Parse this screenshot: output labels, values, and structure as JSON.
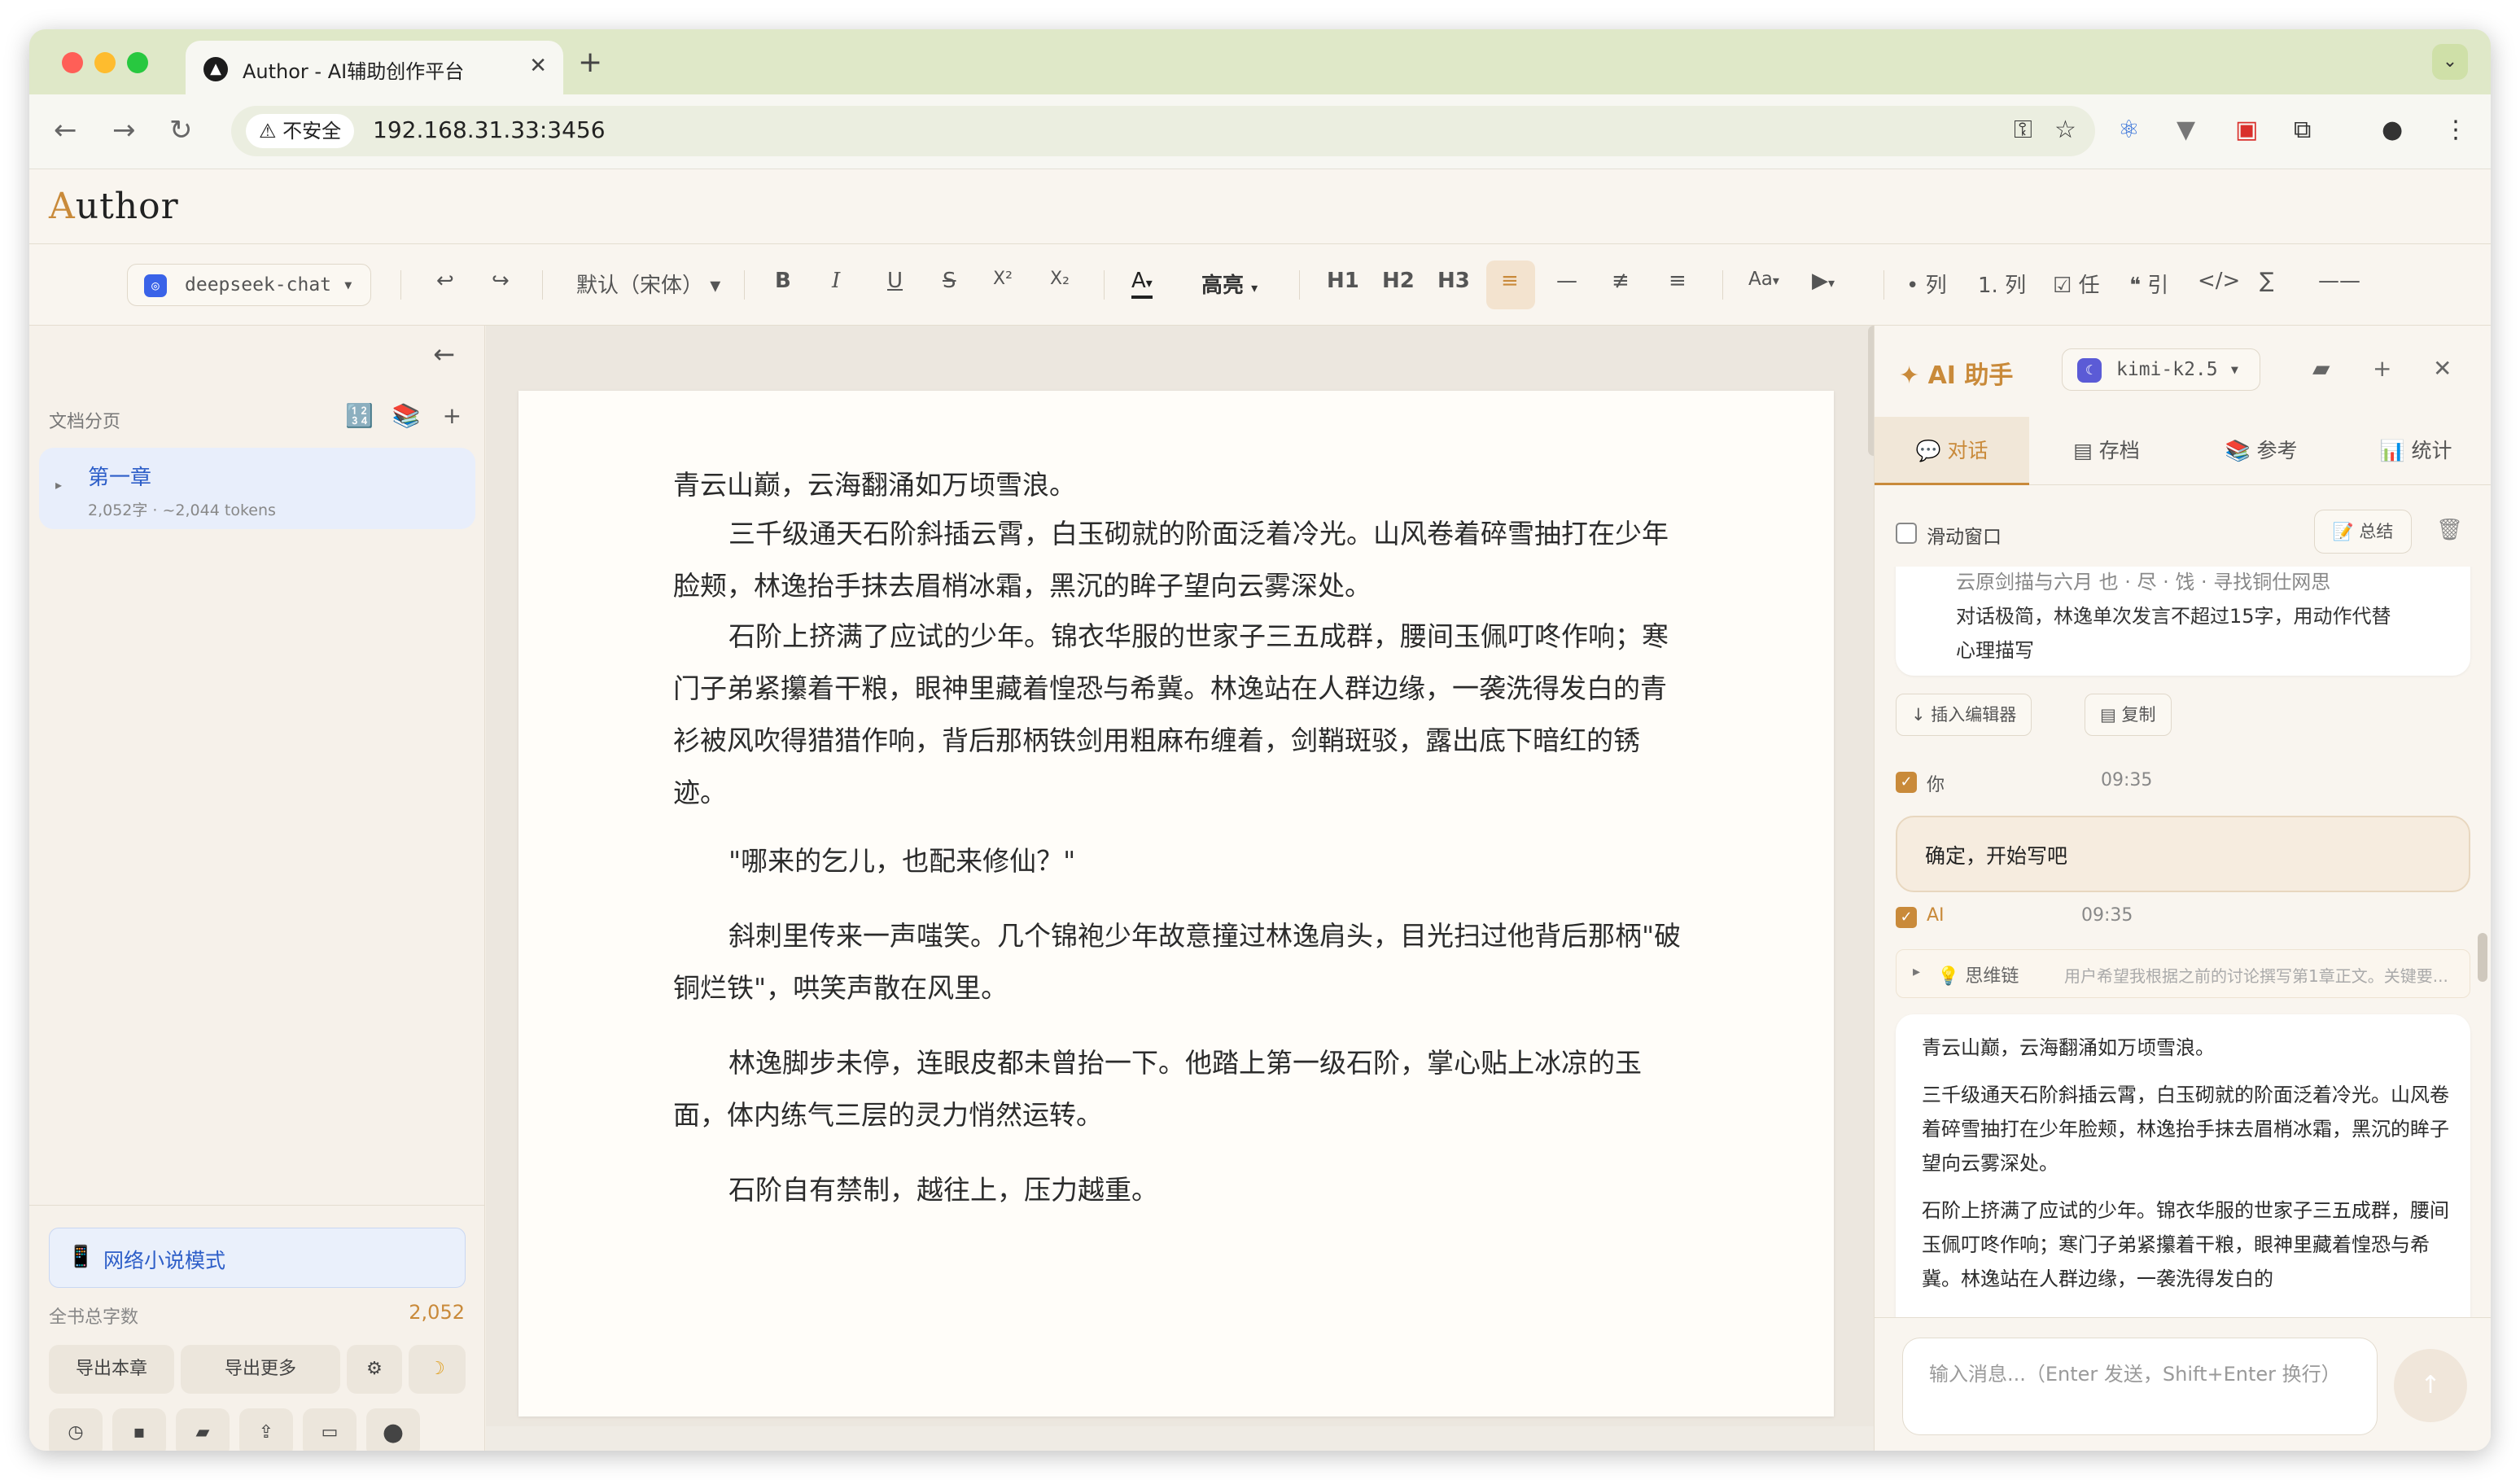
{
  "browser": {
    "tab_title": "Author - AI辅助创作平台",
    "tab_close": "✕",
    "new_tab": "+",
    "tab_menu": "⌄",
    "security_label": "不安全",
    "url": "192.168.31.33:3456",
    "traffic_colors": {
      "close": "#ff5f57",
      "minimize": "#febc2e",
      "maximize": "#28c840"
    }
  },
  "app": {
    "brand_first": "A",
    "brand_rest": "uthor"
  },
  "toolbar": {
    "model": "deepseek-chat",
    "undo": "↩",
    "redo": "↪",
    "font": "默认（宋体）",
    "bold": "B",
    "italic": "I",
    "underline": "U",
    "strike": "S",
    "superscript": "X²",
    "subscript": "X₂",
    "font_color": "A",
    "highlight": "高亮",
    "h1": "H1",
    "h2": "H2",
    "h3": "H3",
    "font_size": "Aa",
    "bullet_list": "• 列",
    "ordered_list": "1. 列",
    "task_list": "☑ 任",
    "quote": "❝ 引",
    "code": "</>",
    "formula": "∑",
    "hr": "——"
  },
  "sidebar": {
    "section_label": "文档分页",
    "chapters": [
      {
        "name": "第一章",
        "meta": "2,052字 · ~2,044 tokens"
      }
    ],
    "mode_label": "网络小说模式",
    "word_count_label": "全书总字数",
    "word_count_value": "2,052",
    "export_chapter": "导出本章",
    "export_more": "导出更多"
  },
  "editor": {
    "paragraphs": [
      "青云山巅，云海翻涌如万顷雪浪。",
      "三千级通天石阶斜插云霄，白玉砌就的阶面泛着冷光。山风卷着碎雪抽打在少年脸颊，林逸抬手抹去眉梢冰霜，黑沉的眸子望向云雾深处。",
      "石阶上挤满了应试的少年。锦衣华服的世家子三五成群，腰间玉佩叮咚作响；寒门子弟紧攥着干粮，眼神里藏着惶恐与希冀。林逸站在人群边缘，一袭洗得发白的青衫被风吹得猎猎作响，背后那柄铁剑用粗麻布缠着，剑鞘斑驳，露出底下暗红的锈迹。",
      "\"哪来的乞儿，也配来修仙？\"",
      "斜刺里传来一声嗤笑。几个锦袍少年故意撞过林逸肩头，目光扫过他背后那柄\"破铜烂铁\"，哄笑声散在风里。",
      "林逸脚步未停，连眼皮都未曾抬一下。他踏上第一级石阶，掌心贴上冰凉的玉面，体内练气三层的灵力悄然运转。",
      "石阶自有禁制，越往上，压力越重。"
    ]
  },
  "ai_panel": {
    "title": "✦ AI 助手",
    "model": "kimi-k2.5",
    "tabs": [
      {
        "label": "💬 对话"
      },
      {
        "label": "▤ 存档"
      },
      {
        "label": "📚 参考"
      },
      {
        "label": "📊 统计"
      }
    ],
    "sliding_window_label": "滑动窗口",
    "summary_label": "📝 总结",
    "prev_message_lines": [
      "云原剑描与六月 也 · 尽 · 饯 · 寻找铜仕网思",
      "对话极简，林逸单次发言不超过15字，用动作代替",
      "心理描写"
    ],
    "insert_editor_label": "↓ 插入编辑器",
    "copy_label": "▤ 复制",
    "user_name": "你",
    "user_time": "09:35",
    "user_message": "确定，开始写吧",
    "ai_name": "AI",
    "ai_time": "09:35",
    "thinking_label": "💡 思维链",
    "thinking_summary": "用户希望我根据之前的讨论撰写第1章正文。关键要...",
    "ai_reply": [
      "青云山巅，云海翻涌如万顷雪浪。",
      "三千级通天石阶斜插云霄，白玉砌就的阶面泛着冷光。山风卷着碎雪抽打在少年脸颊，林逸抬手抹去眉梢冰霜，黑沉的眸子望向云雾深处。",
      "石阶上挤满了应试的少年。锦衣华服的世家子三五成群，腰间玉佩叮咚作响；寒门子弟紧攥着干粮，眼神里藏着惶恐与希冀。林逸站在人群边缘，一袭洗得发白的"
    ],
    "input_placeholder": "输入消息...（Enter 发送，Shift+Enter 换行）"
  }
}
